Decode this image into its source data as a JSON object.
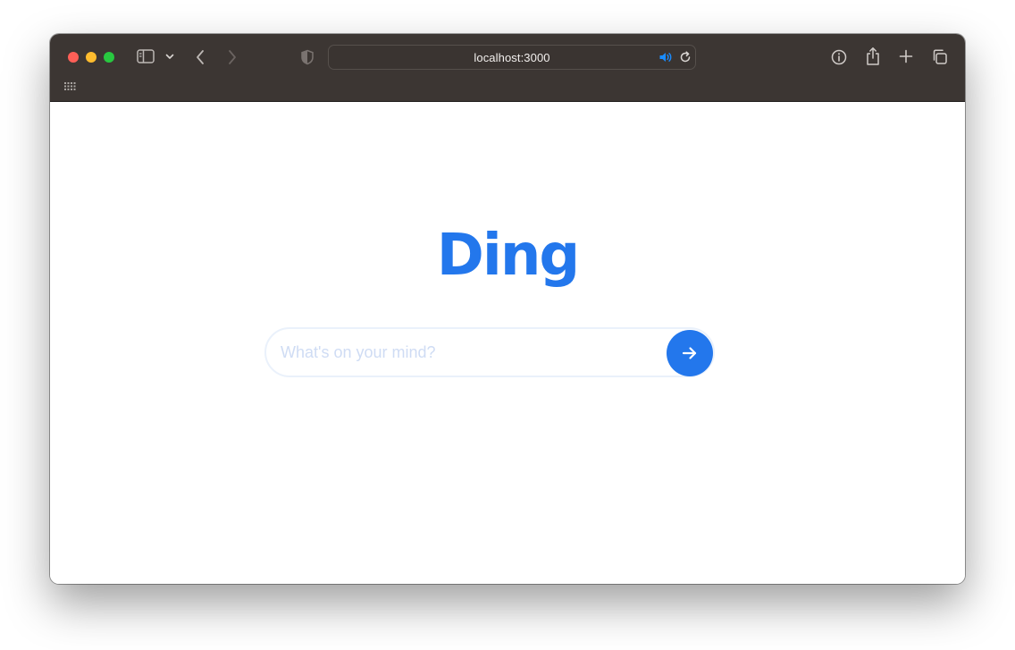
{
  "browser": {
    "address": "localhost:3000",
    "icons": {
      "sidebar": "sidebar-icon",
      "chevron": "chevron-down-icon",
      "back": "back-arrow-icon",
      "forward": "forward-arrow-icon",
      "privacy": "shield-icon",
      "audio": "speaker-icon",
      "reload": "reload-icon",
      "info": "info-icon",
      "share": "share-icon",
      "new_tab": "plus-icon",
      "tab_overview": "tabs-icon",
      "favorites": "grid-icon"
    }
  },
  "page": {
    "logo": "Ding",
    "search": {
      "placeholder": "What's on your mind?",
      "value": ""
    },
    "submit_icon": "arrow-right-icon"
  },
  "colors": {
    "brand": "#2377ec",
    "toolbar": "#3c3633",
    "audio_accent": "#1a8cff"
  }
}
